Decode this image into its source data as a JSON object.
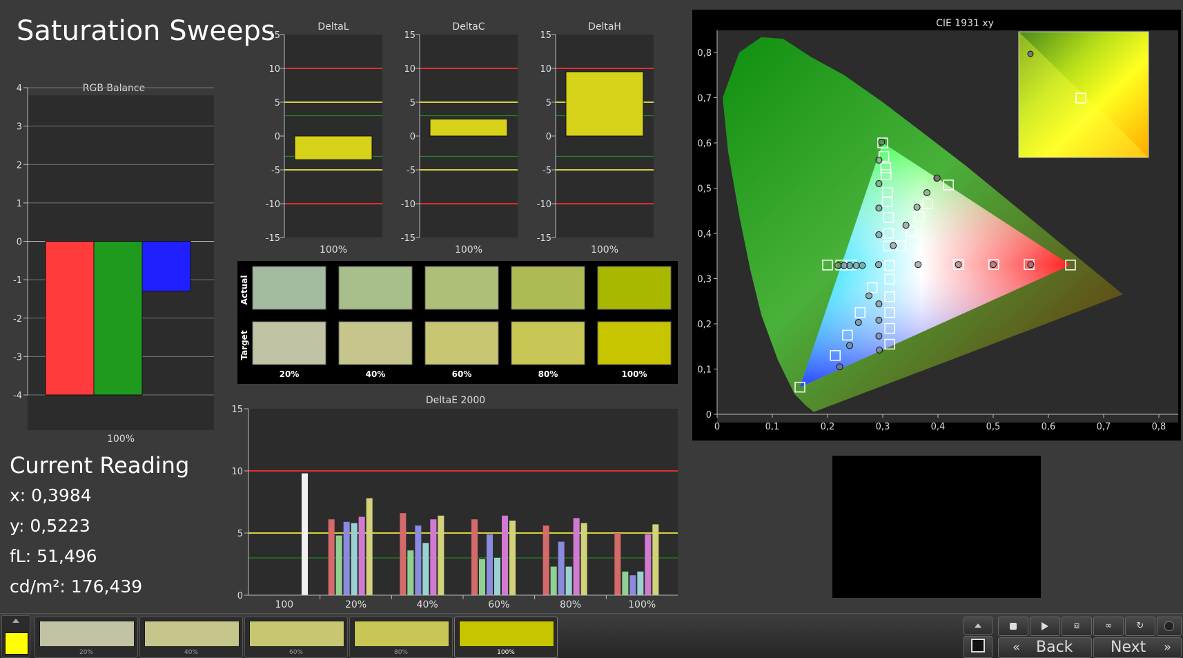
{
  "page_title": "Saturation Sweeps",
  "rgb_balance": {
    "title": "RGB Balance",
    "y_ticks": [
      "4",
      "3",
      "2",
      "1",
      "0",
      "-1",
      "-2",
      "-3",
      "-4"
    ],
    "x_label": "100%",
    "bars": [
      {
        "color": "#ff3b3b",
        "value": -4
      },
      {
        "color": "#1f9a1f",
        "value": -4
      },
      {
        "color": "#2020ff",
        "value": -1.3
      }
    ]
  },
  "delta_charts": [
    {
      "title": "DeltaL",
      "x_label": "100%",
      "value": -3.5
    },
    {
      "title": "DeltaC",
      "x_label": "100%",
      "value": 2.5
    },
    {
      "title": "DeltaH",
      "x_label": "100%",
      "value": 9.5
    }
  ],
  "delta_y_ticks": [
    "15",
    "10",
    "5",
    "0",
    "-5",
    "-10",
    "-15"
  ],
  "swatches": {
    "row_actual": "Actual",
    "row_target": "Target",
    "labels": [
      "20%",
      "40%",
      "60%",
      "80%",
      "100%"
    ],
    "actual_colors": [
      "#a4bba2",
      "#a8be8b",
      "#aec077",
      "#aeba52",
      "#a8b800"
    ],
    "target_colors": [
      "#c2c2a4",
      "#c6c58c",
      "#c8c672",
      "#c8c654",
      "#c7c400"
    ]
  },
  "deltae": {
    "title": "DeltaE 2000",
    "y_ticks": [
      "15",
      "10",
      "5",
      "0"
    ],
    "groups": [
      "100",
      "20%",
      "40%",
      "60%",
      "80%",
      "100%"
    ],
    "series_colors": [
      "#f0f0f0",
      "#d46a6a",
      "#90d090",
      "#8a8ade",
      "#9ad2d2",
      "#d27ad2",
      "#d2d27a"
    ],
    "values": [
      [
        9.8
      ],
      [
        6.1,
        4.8,
        5.9,
        5.8,
        6.3,
        7.8
      ],
      [
        6.6,
        3.6,
        5.6,
        4.2,
        6.1,
        6.4
      ],
      [
        6.1,
        2.9,
        4.9,
        3.0,
        6.4,
        6.0
      ],
      [
        5.6,
        2.3,
        4.3,
        2.3,
        6.2,
        5.8
      ],
      [
        5.0,
        1.9,
        1.6,
        1.9,
        4.9,
        5.7
      ]
    ]
  },
  "cie": {
    "title": "CIE 1931 xy",
    "x_ticks": [
      "0",
      "0,1",
      "0,2",
      "0,3",
      "0,4",
      "0,5",
      "0,6",
      "0,7",
      "0,8"
    ],
    "y_ticks": [
      "0",
      "0,1",
      "0,2",
      "0,3",
      "0,4",
      "0,5",
      "0,6",
      "0,7",
      "0,8"
    ],
    "gamut": [
      [
        0.64,
        0.33
      ],
      [
        0.3,
        0.6
      ],
      [
        0.15,
        0.06
      ]
    ],
    "targets": [
      [
        0.3127,
        0.329
      ],
      [
        0.3127,
        0.329
      ],
      [
        0.371,
        0.331
      ],
      [
        0.437,
        0.331
      ],
      [
        0.501,
        0.331
      ],
      [
        0.565,
        0.331
      ],
      [
        0.64,
        0.33
      ],
      [
        0.3105,
        0.4
      ],
      [
        0.308,
        0.47
      ],
      [
        0.306,
        0.53
      ],
      [
        0.302,
        0.57
      ],
      [
        0.3,
        0.6
      ],
      [
        0.281,
        0.28
      ],
      [
        0.259,
        0.225
      ],
      [
        0.236,
        0.175
      ],
      [
        0.214,
        0.13
      ],
      [
        0.15,
        0.06
      ],
      [
        0.3127,
        0.299
      ],
      [
        0.3127,
        0.26
      ],
      [
        0.3127,
        0.225
      ],
      [
        0.3127,
        0.19
      ],
      [
        0.3127,
        0.155
      ],
      [
        0.243,
        0.33
      ],
      [
        0.224,
        0.33
      ],
      [
        0.2,
        0.33
      ],
      [
        0.333,
        0.373
      ],
      [
        0.351,
        0.405
      ],
      [
        0.366,
        0.437
      ],
      [
        0.381,
        0.466
      ],
      [
        0.419,
        0.507
      ],
      [
        0.3105,
        0.372
      ],
      [
        0.3105,
        0.435
      ],
      [
        0.3085,
        0.49
      ],
      [
        0.3055,
        0.545
      ]
    ],
    "measured": [
      [
        0.2925,
        0.331
      ],
      [
        0.364,
        0.331
      ],
      [
        0.437,
        0.331
      ],
      [
        0.5,
        0.331
      ],
      [
        0.568,
        0.331
      ],
      [
        0.293,
        0.397
      ],
      [
        0.293,
        0.456
      ],
      [
        0.293,
        0.51
      ],
      [
        0.293,
        0.562
      ],
      [
        0.298,
        0.602
      ],
      [
        0.275,
        0.262
      ],
      [
        0.256,
        0.203
      ],
      [
        0.24,
        0.152
      ],
      [
        0.222,
        0.105
      ],
      [
        0.293,
        0.244
      ],
      [
        0.293,
        0.208
      ],
      [
        0.293,
        0.173
      ],
      [
        0.294,
        0.142
      ],
      [
        0.263,
        0.329
      ],
      [
        0.252,
        0.329
      ],
      [
        0.24,
        0.329
      ],
      [
        0.23,
        0.329
      ],
      [
        0.219,
        0.329
      ],
      [
        0.319,
        0.373
      ],
      [
        0.342,
        0.418
      ],
      [
        0.362,
        0.458
      ],
      [
        0.38,
        0.49
      ],
      [
        0.398,
        0.522
      ]
    ],
    "current": [
      0.3984,
      0.5223
    ],
    "inset_target": [
      0.38,
      0.49
    ],
    "inset_measured": [
      0.3984,
      0.5223
    ]
  },
  "current_reading": {
    "title": "Current Reading",
    "x": "x: 0,3984",
    "y": "y: 0,5223",
    "fl": "fL: 51,496",
    "cdm2": "cd/m²: 176,439"
  },
  "bottom_bar": {
    "current_color": "#ffff00",
    "patches": [
      {
        "label": "20%",
        "color": "#c2c2a4"
      },
      {
        "label": "40%",
        "color": "#c6c58c"
      },
      {
        "label": "60%",
        "color": "#c8c672"
      },
      {
        "label": "80%",
        "color": "#c8c654"
      },
      {
        "label": "100%",
        "color": "#c7c400"
      }
    ],
    "back_label": "Back",
    "next_label": "Next"
  }
}
